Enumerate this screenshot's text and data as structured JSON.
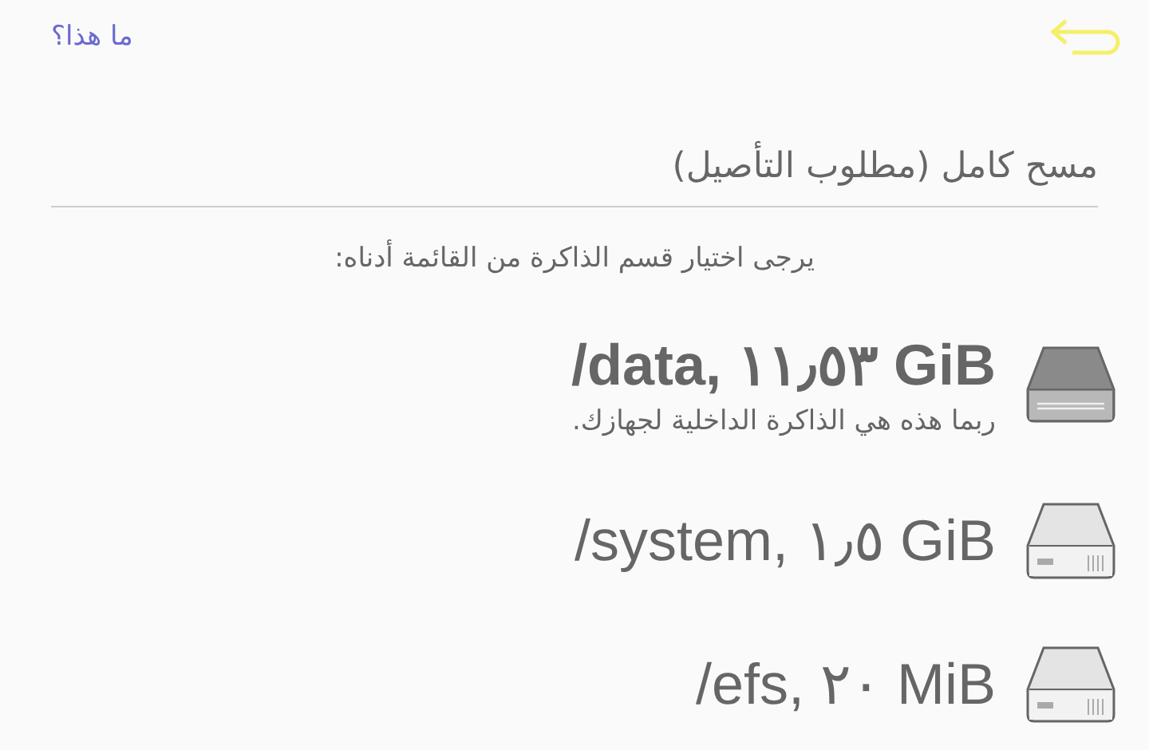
{
  "top_bar": {
    "help_link": "ما هذا؟"
  },
  "heading": "مسح كامل (مطلوب التأصيل)",
  "instruction": "يرجى اختيار قسم الذاكرة من القائمة أدناه:",
  "partitions": [
    {
      "title": "/data, ١١٫٥٣ GiB",
      "subtitle": "ربما هذه هي الذاكرة الداخلية لجهازك.",
      "selected": true
    },
    {
      "title": "/system, ١٫٥ GiB",
      "selected": false
    },
    {
      "title": "/efs, ٢٠ MiB",
      "selected": false
    }
  ]
}
